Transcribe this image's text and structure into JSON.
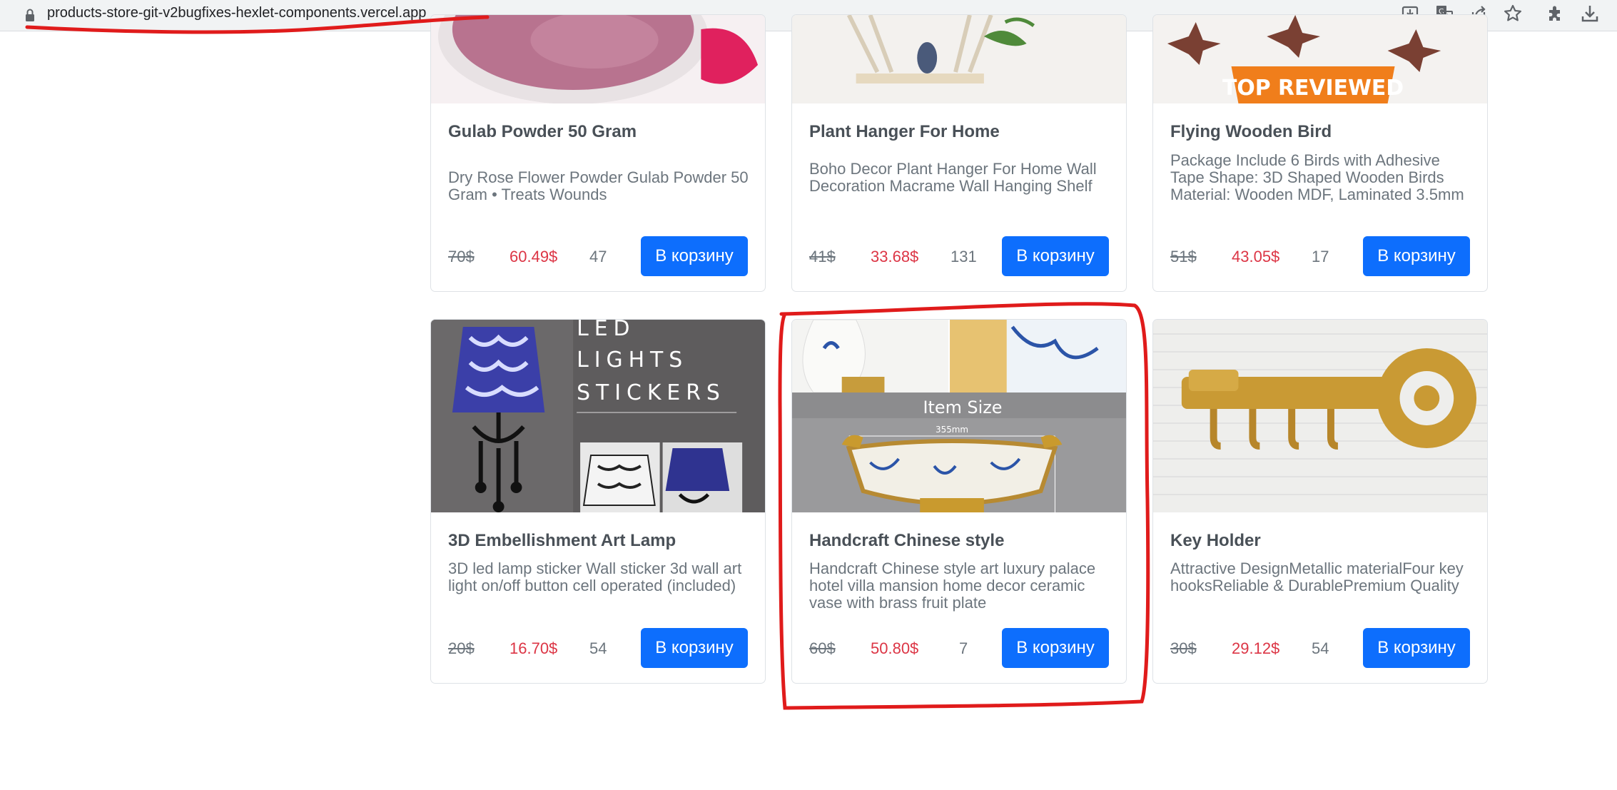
{
  "browser": {
    "url": "products-store-git-v2bugfixes-hexlet-components.vercel.app",
    "icons": [
      "lock-icon",
      "install-icon",
      "translate-icon",
      "share-icon",
      "star-icon",
      "extensions-icon",
      "download-icon"
    ]
  },
  "products": [
    {
      "title": "Gulab Powder 50 Gram",
      "description": "Dry Rose Flower Powder Gulab Powder 50 Gram • Treats Wounds",
      "old_price": "70$",
      "price": "60.49$",
      "stock": "47",
      "button": "В корзину"
    },
    {
      "title": "Plant Hanger For Home",
      "description": "Boho Decor Plant Hanger For Home Wall Decoration Macrame Wall Hanging Shelf",
      "old_price": "41$",
      "price": "33.68$",
      "stock": "131",
      "button": "В корзину"
    },
    {
      "title": "Flying Wooden Bird",
      "description": "Package Include 6 Birds with Adhesive Tape Shape: 3D Shaped Wooden Birds Material: Wooden MDF, Laminated 3.5mm",
      "old_price": "51$",
      "price": "43.05$",
      "stock": "17",
      "button": "В корзину",
      "image_text": "TOP REVIEWED"
    },
    {
      "title": "3D Embellishment Art Lamp",
      "description": "3D led lamp sticker Wall sticker 3d wall art light on/off button cell operated (included)",
      "old_price": "20$",
      "price": "16.70$",
      "stock": "54",
      "button": "В корзину",
      "image_text": [
        "LED",
        "LIGHTS",
        "STICKERS"
      ]
    },
    {
      "title": "Handcraft Chinese style",
      "description": "Handcraft Chinese style art luxury palace hotel villa mansion home decor ceramic vase with brass fruit plate",
      "old_price": "60$",
      "price": "50.80$",
      "stock": "7",
      "button": "В корзину",
      "image_text": [
        "Item Size",
        "355mm"
      ]
    },
    {
      "title": "Key Holder",
      "description": "Attractive DesignMetallic materialFour key hooksReliable & DurablePremium Quality",
      "old_price": "30$",
      "price": "29.12$",
      "stock": "54",
      "button": "В корзину"
    }
  ],
  "colors": {
    "accent": "#0d6efd",
    "sale": "#dc3545",
    "annotation": "#e01b1b"
  }
}
